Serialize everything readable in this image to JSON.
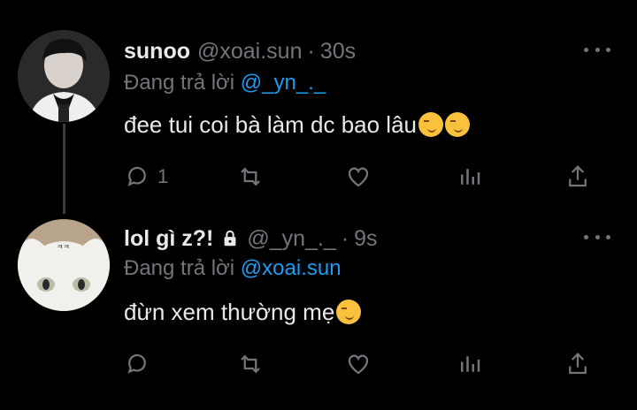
{
  "tweets": [
    {
      "name": "sunoo",
      "handle": "@xoai.sun",
      "separator": "·",
      "time": "30s",
      "replying_prefix": "Đang trả lời",
      "replying_to": "@_yn_._",
      "text": "đee tui coi bà làm dc bao lâu",
      "emoji_count": 2,
      "reply_count": "1",
      "icons": [
        "reply-icon",
        "retweet-icon",
        "like-icon",
        "views-icon",
        "share-icon"
      ]
    },
    {
      "name": "lol gì z?!",
      "handle": "@_yn_._",
      "separator": "·",
      "time": "9s",
      "replying_prefix": "Đang trả lời",
      "replying_to": "@xoai.sun",
      "text": "đừn xem thường mẹ",
      "emoji_count": 1,
      "reply_count": "",
      "icons": [
        "reply-icon",
        "retweet-icon",
        "like-icon",
        "views-icon",
        "share-icon"
      ],
      "avatar_text": "ㅋㅋ"
    }
  ],
  "colors": {
    "background": "#000000",
    "text": "#e7e9ea",
    "muted": "#71767b",
    "accent": "#1d9bf0",
    "thread_line": "#3a3d42"
  }
}
